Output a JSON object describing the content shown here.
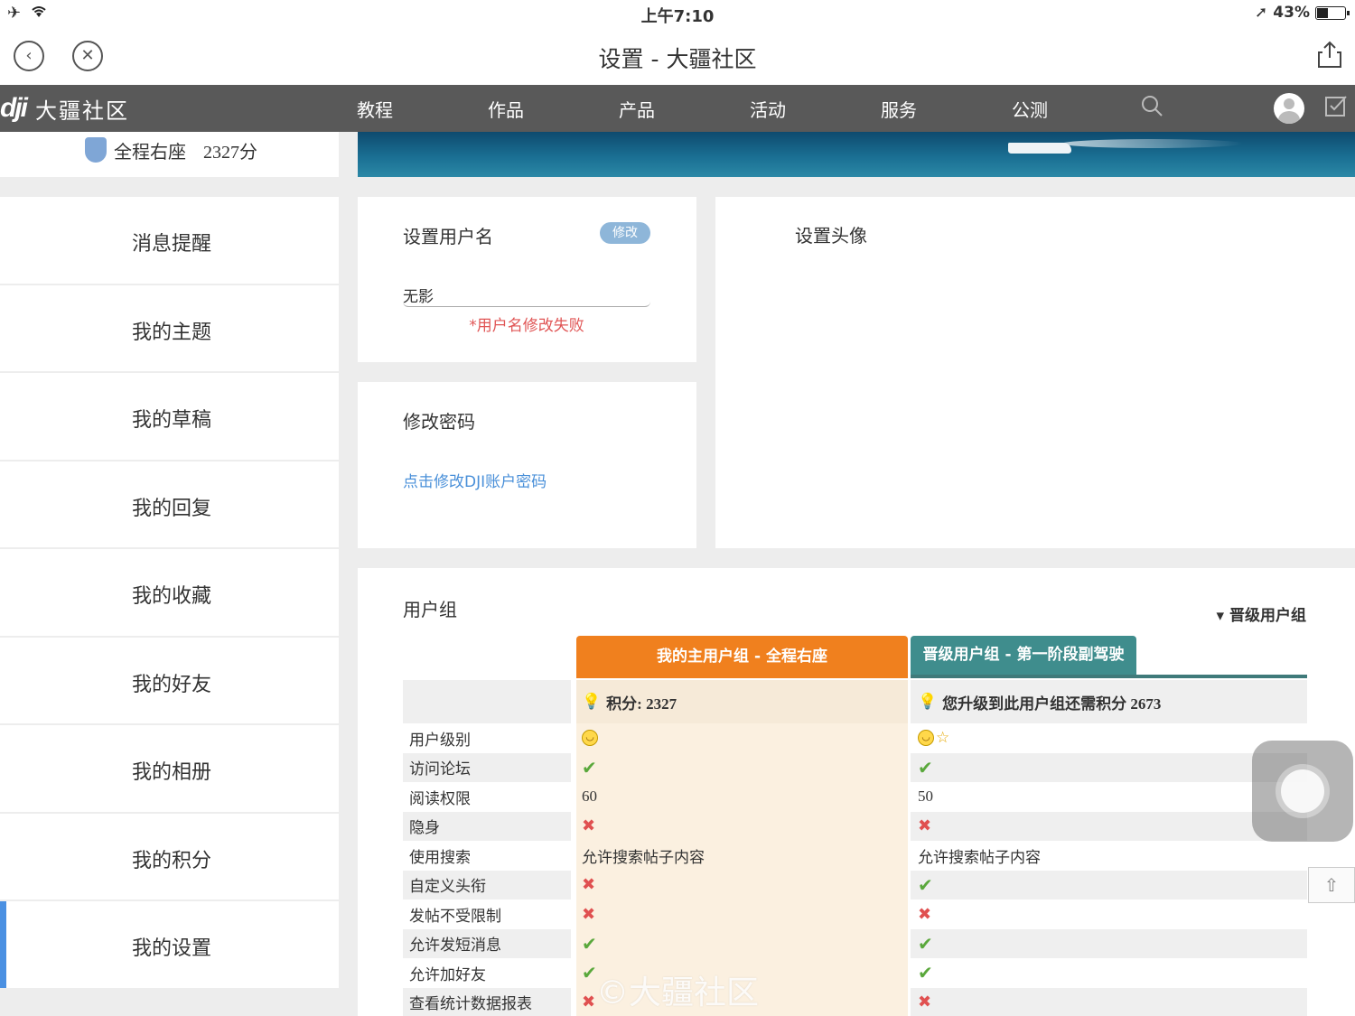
{
  "status_bar": {
    "time": "上午7:10",
    "battery": "43%",
    "battery_level": 0.43
  },
  "browser": {
    "title": "设置 - 大疆社区"
  },
  "site_header": {
    "logo_mark": "dji",
    "logo_text": "大疆社区",
    "menu": [
      "教程",
      "作品",
      "产品",
      "活动",
      "服务",
      "公测"
    ]
  },
  "profile": {
    "rank": "全程右座",
    "score": "2327分"
  },
  "sidebar": {
    "items": [
      {
        "label": "消息提醒"
      },
      {
        "label": "我的主题"
      },
      {
        "label": "我的草稿"
      },
      {
        "label": "我的回复"
      },
      {
        "label": "我的收藏"
      },
      {
        "label": "我的好友"
      },
      {
        "label": "我的相册"
      },
      {
        "label": "我的积分"
      },
      {
        "label": "我的设置"
      }
    ],
    "active": "我的设置"
  },
  "username_card": {
    "title": "设置用户名",
    "edit_label": "修改",
    "value": "无影",
    "error": "*用户名修改失败"
  },
  "password_card": {
    "title": "修改密码",
    "link": "点击修改DJI账户密码"
  },
  "avatar_card": {
    "title": "设置头像"
  },
  "user_group": {
    "title": "用户组",
    "upgrade_toggle": "▾ 晋级用户组",
    "current_tab": "我的主用户组 - 全程右座",
    "next_tab": "晋级用户组 - 第一阶段副驾驶",
    "current_points": "积分: 2327",
    "next_points": "您升级到此用户组还需积分 2673",
    "rows": [
      {
        "label": "用户级别",
        "cur": "face",
        "next": "face-star"
      },
      {
        "label": "访问论坛",
        "cur": "ok",
        "next": "ok"
      },
      {
        "label": "阅读权限",
        "cur": "60",
        "next": "50"
      },
      {
        "label": "隐身",
        "cur": "no",
        "next": "no"
      },
      {
        "label": "使用搜索",
        "cur": "允许搜索帖子内容",
        "next": "允许搜索帖子内容"
      },
      {
        "label": "自定义头衔",
        "cur": "no",
        "next": "ok"
      },
      {
        "label": "发帖不受限制",
        "cur": "no",
        "next": "no"
      },
      {
        "label": "允许发短消息",
        "cur": "ok",
        "next": "ok"
      },
      {
        "label": "允许加好友",
        "cur": "ok",
        "next": "ok"
      },
      {
        "label": "查看统计数据报表",
        "cur": "no",
        "next": "no"
      }
    ]
  },
  "watermark": "©大疆社区",
  "colors": {
    "accent_orange": "#f0801e",
    "accent_teal": "#3f8d8d",
    "active_blue": "#4a90e2",
    "error_red": "#e05555"
  }
}
